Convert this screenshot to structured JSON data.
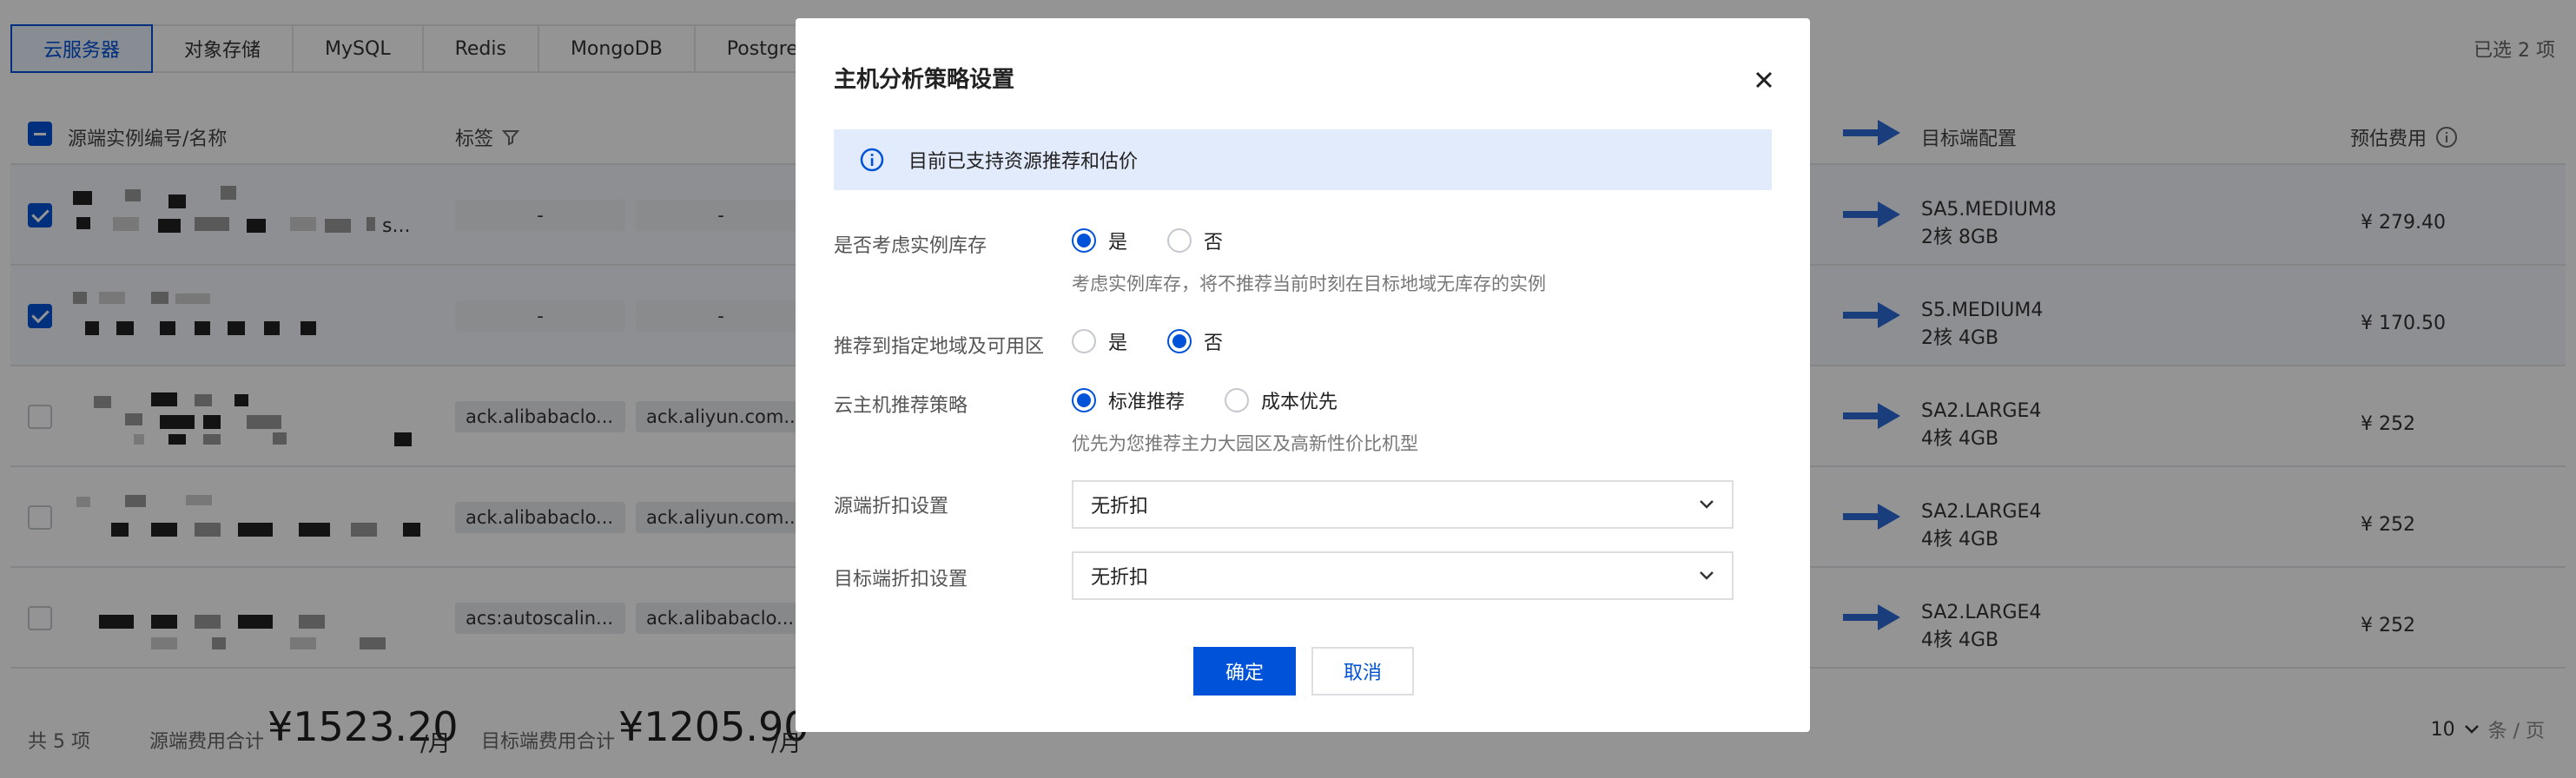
{
  "tabs": [
    {
      "label": "云服务器",
      "active": true
    },
    {
      "label": "对象存储",
      "active": false
    },
    {
      "label": "MySQL",
      "active": false
    },
    {
      "label": "Redis",
      "active": false
    },
    {
      "label": "MongoDB",
      "active": false
    },
    {
      "label": "PostgreSQL",
      "active": false
    }
  ],
  "selected_count": "已选 2 项",
  "table": {
    "headers": {
      "source": "源端实例编号/名称",
      "tags": "标签",
      "target_config": "目标端配置",
      "estimated_cost": "预估费用"
    },
    "rows": [
      {
        "selected": true,
        "tag1": "-",
        "tag2": "-",
        "spec": "SA5.MEDIUM8",
        "size": "2核 8GB",
        "cost": "¥ 279.40",
        "name_suffix": "s..."
      },
      {
        "selected": true,
        "tag1": "-",
        "tag2": "-",
        "spec": "S5.MEDIUM4",
        "size": "2核 4GB",
        "cost": "¥ 170.50",
        "name_suffix": ""
      },
      {
        "selected": false,
        "tag1": "ack.alibabaclo...",
        "tag2": "ack.aliyun.com...",
        "spec": "SA2.LARGE4",
        "size": "4核 4GB",
        "cost": "¥ 252",
        "name_suffix": ""
      },
      {
        "selected": false,
        "tag1": "ack.alibabaclo...",
        "tag2": "ack.aliyun.com...",
        "spec": "SA2.LARGE4",
        "size": "4核 4GB",
        "cost": "¥ 252",
        "name_suffix": ""
      },
      {
        "selected": false,
        "tag1": "acs:autoscalin...",
        "tag2": "ack.alibabaclo...",
        "spec": "SA2.LARGE4",
        "size": "4核 4GB",
        "cost": "¥ 252",
        "name_suffix": ""
      }
    ]
  },
  "footer": {
    "total": "共 5 项",
    "source_fee_label": "源端费用合计",
    "source_fee_value": "¥1523.20",
    "target_fee_label": "目标端费用合计",
    "target_fee_value": "¥1205.90",
    "unit": "/月",
    "page_size": "10",
    "page_size_unit": "条 / 页"
  },
  "dialog": {
    "title": "主机分析策略设置",
    "notice": "目前已支持资源推荐和估价",
    "inventory": {
      "label": "是否考虑实例库存",
      "options": [
        "是",
        "否"
      ],
      "selected": 0,
      "help": "考虑实例库存，将不推荐当前时刻在目标地域无库存的实例"
    },
    "region": {
      "label": "推荐到指定地域及可用区",
      "options": [
        "是",
        "否"
      ],
      "selected": 1
    },
    "strategy": {
      "label": "云主机推荐策略",
      "options": [
        "标准推荐",
        "成本优先"
      ],
      "selected": 0,
      "help": "优先为您推荐主力大园区及高新性价比机型"
    },
    "source_discount": {
      "label": "源端折扣设置",
      "value": "无折扣"
    },
    "target_discount": {
      "label": "目标端折扣设置",
      "value": "无折扣"
    },
    "confirm": "确定",
    "cancel": "取消"
  },
  "colors": {
    "accent": "#0052d9",
    "notice_bg": "#e2ebfc"
  }
}
